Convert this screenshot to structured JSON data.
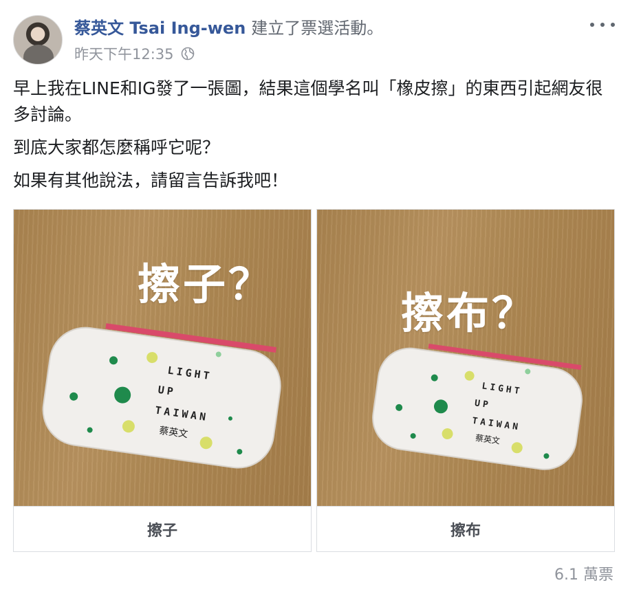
{
  "post": {
    "author": "蔡英文 Tsai Ing-wen",
    "action": "建立了票選活動。",
    "timestamp": "昨天下午12:35",
    "privacy_icon": "globe-icon",
    "paragraphs": [
      "早上我在LINE和IG發了一張圖，結果這個學名叫「橡皮擦」的東西引起網友很多討論。",
      "到底大家都怎麼稱呼它呢？",
      "如果有其他說法，請留言告訴我吧！"
    ]
  },
  "poll": {
    "options": [
      {
        "label": "擦子",
        "overlay_text": "擦子？",
        "product_text": [
          "LIGHT",
          "UP",
          "TAIWAN",
          "蔡英文"
        ]
      },
      {
        "label": "擦布",
        "overlay_text": "擦布？",
        "product_text": [
          "LIGHT",
          "UP",
          "TAIWAN",
          "蔡英文"
        ]
      }
    ],
    "total_votes": "6.1 萬票"
  },
  "colors": {
    "author": "#365899",
    "meta": "#90949c",
    "text": "#1c1e21",
    "border": "#dadde1"
  }
}
